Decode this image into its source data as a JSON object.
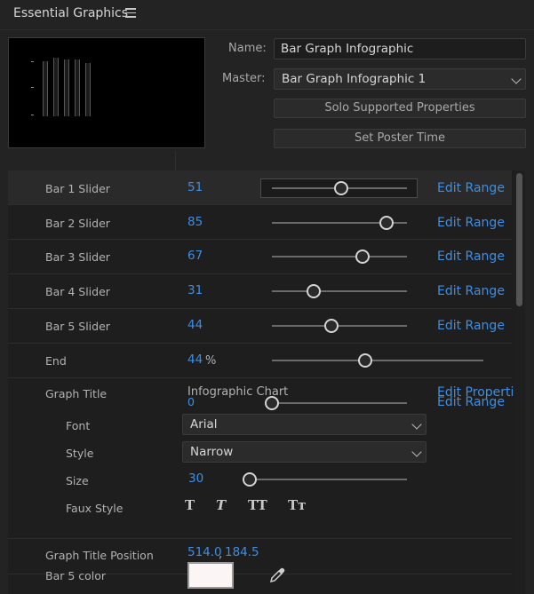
{
  "panel": {
    "title": "Essential Graphics"
  },
  "meta": {
    "name_label": "Name:",
    "name_value": "Bar Graph Infographic",
    "master_label": "Master:",
    "master_value": "Bar Graph Infographic 1",
    "solo_button": "Solo Supported Properties",
    "poster_button": "Set Poster Time"
  },
  "bars": [
    {
      "label": "Bar 1 Slider",
      "value": "51",
      "level": 51,
      "link": "Edit Range"
    },
    {
      "label": "Bar 2 Slider",
      "value": "85",
      "level": 85,
      "link": "Edit Range"
    },
    {
      "label": "Bar 3 Slider",
      "value": "67",
      "level": 67,
      "link": "Edit Range"
    },
    {
      "label": "Bar 4 Slider",
      "value": "31",
      "level": 31,
      "link": "Edit Range"
    },
    {
      "label": "Bar 5 Slider",
      "value": "44",
      "level": 44,
      "link": "Edit Range"
    }
  ],
  "end": {
    "label": "End",
    "value": "44",
    "unit": "%",
    "level": 44
  },
  "graph_title": {
    "label": "Graph Title",
    "text": "Infographic Chart",
    "link": "Edit Propertie",
    "overlap_value": "0",
    "overlap_link": "Edit Range",
    "font_label": "Font",
    "font_value": "Arial",
    "style_label": "Style",
    "style_value": "Narrow",
    "size_label": "Size",
    "size_value": "30",
    "size_level": 0,
    "faux_label": "Faux Style",
    "faux_buttons": [
      "T",
      "T",
      "TT",
      "Tт"
    ]
  },
  "position": {
    "label": "Graph Title Position",
    "x": "514.0",
    "sep": ",",
    "y": "184.5"
  },
  "bar5_color": {
    "label": "Bar 5 color",
    "color": "#fbf6f5"
  },
  "colors": {
    "accent": "#3d8ee6",
    "background": "#232323"
  }
}
